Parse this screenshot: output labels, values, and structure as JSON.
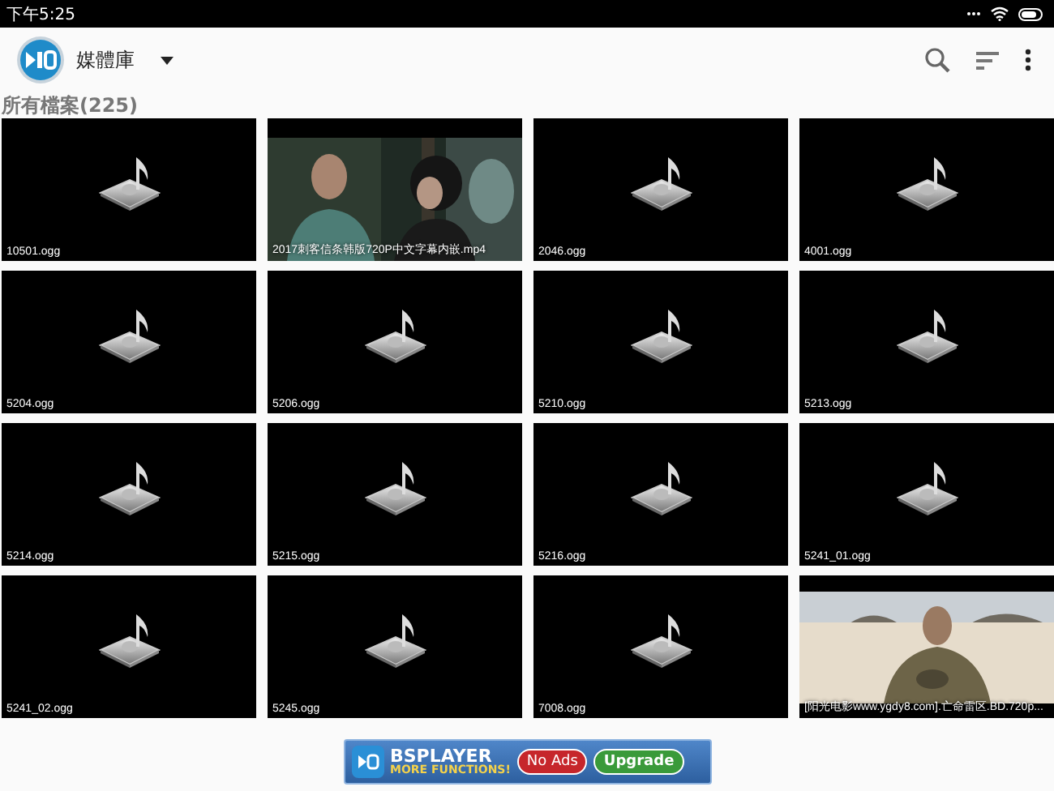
{
  "status_bar": {
    "time": "下午5:25"
  },
  "app_bar": {
    "title": "媒體庫"
  },
  "section": {
    "title": "所有檔案(225)"
  },
  "files": [
    {
      "name": "10501.ogg",
      "kind": "audio"
    },
    {
      "name": "2017刺客信条韩版720P中文字幕内嵌.mp4",
      "kind": "video"
    },
    {
      "name": "2046.ogg",
      "kind": "audio"
    },
    {
      "name": "4001.ogg",
      "kind": "audio"
    },
    {
      "name": "5204.ogg",
      "kind": "audio"
    },
    {
      "name": "5206.ogg",
      "kind": "audio"
    },
    {
      "name": "5210.ogg",
      "kind": "audio"
    },
    {
      "name": "5213.ogg",
      "kind": "audio"
    },
    {
      "name": "5214.ogg",
      "kind": "audio"
    },
    {
      "name": "5215.ogg",
      "kind": "audio"
    },
    {
      "name": "5216.ogg",
      "kind": "audio"
    },
    {
      "name": "5241_01.ogg",
      "kind": "audio"
    },
    {
      "name": "5241_02.ogg",
      "kind": "audio"
    },
    {
      "name": "5245.ogg",
      "kind": "audio"
    },
    {
      "name": "7008.ogg",
      "kind": "audio"
    },
    {
      "name": "[阳光电影www.ygdy8.com].亡命雷区.BD.720p...",
      "kind": "desert"
    }
  ],
  "ad_banner": {
    "brand": "BSPLAYER",
    "tagline": "MORE FUNCTIONS!",
    "no_ads": "No Ads",
    "upgrade": "Upgrade"
  }
}
